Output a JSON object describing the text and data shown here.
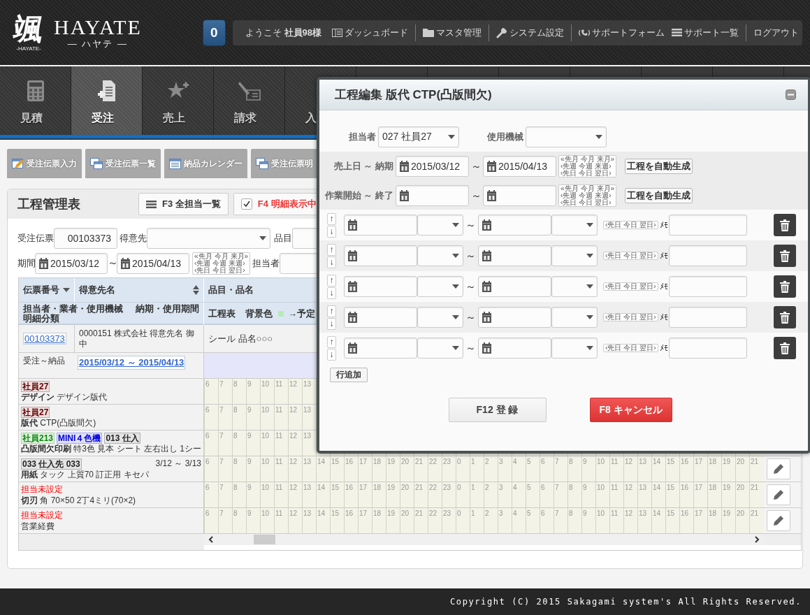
{
  "header": {
    "logo": {
      "mark": "颯",
      "tagline": "-HAYATE-",
      "name": "HAYATE",
      "reading": "— ハヤテ —"
    },
    "badge": "0",
    "greeting": "ようこそ **社員98様**",
    "links": [
      {
        "kind": "dashboard",
        "label": "ダッシュボード",
        "separated": false
      },
      {
        "kind": "folder",
        "label": "マスタ管理",
        "separated": true
      },
      {
        "kind": "settings",
        "label": "システム設定",
        "separated": true
      },
      {
        "kind": "phone",
        "label": "サポートフォーム",
        "separated": true
      },
      {
        "kind": "list",
        "label": "サポート一覧",
        "separated": false
      },
      {
        "kind": "logout",
        "label": "ログアウト",
        "separated": true
      }
    ]
  },
  "nav": {
    "tabs": [
      {
        "kind": "estimate",
        "label": "見積",
        "selected": false
      },
      {
        "kind": "order",
        "label": "受注",
        "selected": true
      },
      {
        "kind": "sales",
        "label": "売上",
        "selected": false
      },
      {
        "kind": "billing",
        "label": "請求",
        "selected": false
      },
      {
        "kind": "receipt",
        "label": "入",
        "selected": false
      }
    ]
  },
  "subnav": [
    {
      "kind": "edit",
      "label": "受注伝票入力"
    },
    {
      "kind": "windows",
      "label": "受注伝票一覧"
    },
    {
      "kind": "calendar",
      "label": "納品カレンダー"
    },
    {
      "kind": "windows",
      "label": "受注伝票明"
    }
  ],
  "panel": {
    "title": "工程管理表",
    "buttons": [
      {
        "kind": "list",
        "label": "F3 全担当一覧"
      },
      {
        "kind": "toggle",
        "label": "F4 明細表示中",
        "checked": true
      }
    ],
    "filters": {
      "order_no": {
        "label": "受注伝票",
        "value": "00103373"
      },
      "customer": {
        "label": "得意先"
      },
      "item": {
        "label": "品目"
      },
      "period": {
        "label": "期間",
        "from": "2015/03/12",
        "sep": "～",
        "to": "2015/04/13",
        "quick_pick": [
          [
            "«先月",
            "今月",
            "来月»"
          ],
          [
            "‹先週",
            "今週",
            "来週›"
          ],
          [
            "‹先日",
            "今日",
            "翌日›"
          ]
        ]
      },
      "staff": {
        "label": "担当者"
      }
    },
    "table": {
      "columns": [
        {
          "label": "伝票番号",
          "kind": "descending"
        },
        {
          "label": "得意先名",
          "kind": "sortable"
        },
        {
          "label": "品目・品名",
          "kind": "plain"
        }
      ],
      "subheader": {
        "assignee": "担当者・業者・使用機械",
        "due": "納期・使用期間",
        "category": "明細分類",
        "schedule": "工程表",
        "bg_label": "背景色",
        "legend": "→予定"
      },
      "order": {
        "number": "00103373",
        "customer": "0000151 株式会社 得意先名 御中",
        "item": "シール 品名○○○"
      },
      "span": {
        "label": "受注～納品",
        "dates": "2015/03/12 ～ 2015/04/13"
      },
      "rows": [
        {
          "tags": [
            {
              "kind": "tag",
              "text": "社員27",
              "color": "#660000"
            }
          ],
          "text": "**デザイン** デザイン版代",
          "hours": [
            "6",
            "7",
            "8",
            "9",
            "10",
            "11",
            "12",
            "13"
          ]
        },
        {
          "tags": [
            {
              "kind": "tag",
              "text": "社員27",
              "color": "#660000"
            }
          ],
          "text": "**版代** CTP(凸版間欠)",
          "hours": [
            "6",
            "7",
            "8",
            "9",
            "10",
            "11",
            "12",
            "13"
          ]
        },
        {
          "tags": [
            {
              "kind": "tag",
              "text": "社員213",
              "color": "#0a8a0a"
            },
            {
              "kind": "tag",
              "text": "MINI４色機",
              "color": "#0000dd"
            },
            {
              "kind": "tag",
              "text": "013 仕入",
              "color": "#222222"
            }
          ],
          "text": "**凸版間欠印刷** 特3色 見本 シート 左右出し 1シー",
          "hours": [
            "6",
            "7",
            "8",
            "9",
            "10",
            "11",
            "12",
            "13"
          ]
        },
        {
          "tags": [
            {
              "kind": "tag",
              "text": "033 仕入先 033",
              "color": "#222222"
            }
          ],
          "period": "3/12 ～ 3/13",
          "text": "**用紙** タック 上質70 訂正用 キセパ",
          "editable": true,
          "hours": [
            "6",
            "7",
            "8",
            "9",
            "10",
            "11",
            "12",
            "13",
            "14",
            "15",
            "16",
            "17",
            "18",
            "19",
            "20",
            "21",
            "22",
            "23",
            "0",
            "1",
            "2",
            "3",
            "4",
            "5",
            "6",
            "7",
            "8",
            "9",
            "10",
            "11",
            "12",
            "13",
            "14",
            "15",
            "16",
            "17",
            "18",
            "19",
            "20",
            "21"
          ]
        },
        {
          "tags": [
            {
              "kind": "plain",
              "text": "担当未設定"
            }
          ],
          "text": "**切刃** 角 70×50 2丁4ミリ(70×2)",
          "editable": true,
          "hours": [
            "6",
            "7",
            "8",
            "9",
            "10",
            "11",
            "12",
            "13",
            "14",
            "15",
            "16",
            "17",
            "18",
            "19",
            "20",
            "21",
            "22",
            "23",
            "0",
            "1",
            "2",
            "3",
            "4",
            "5",
            "6",
            "7",
            "8",
            "9",
            "10",
            "11",
            "12",
            "13",
            "14",
            "15",
            "16",
            "17",
            "18",
            "19",
            "20",
            "21"
          ]
        },
        {
          "tags": [
            {
              "kind": "plain",
              "text": "担当未設定"
            }
          ],
          "text": "営業経費",
          "editable": true,
          "hours": [
            "6",
            "7",
            "8",
            "9",
            "10",
            "11",
            "12",
            "13",
            "14",
            "15",
            "16",
            "17",
            "18",
            "19",
            "20",
            "21",
            "22",
            "23",
            "0",
            "1",
            "2",
            "3",
            "4",
            "5",
            "6",
            "7",
            "8",
            "9",
            "10",
            "11",
            "12",
            "13",
            "14",
            "15",
            "16",
            "17",
            "18",
            "19",
            "20",
            "21"
          ]
        }
      ]
    }
  },
  "modal": {
    "title": "工程編集 版代 CTP(凸版間欠)",
    "staff": {
      "label": "担当者",
      "value": "027 社員27"
    },
    "machine": {
      "label": "使用機械"
    },
    "ranges": [
      {
        "label": "売上日 ～ 納期",
        "from": "2015/03/12",
        "sep": "～",
        "to": "2015/04/13",
        "quick_pick": [
          [
            "«先月",
            "今月",
            "来月»"
          ],
          [
            "‹先週",
            "今週",
            "来週›"
          ],
          [
            "‹先日",
            "今日",
            "翌日›"
          ]
        ],
        "button": "工程を自動生成"
      },
      {
        "label": "作業開始 ～ 終了",
        "sep": "～",
        "quick_pick": [
          [
            "«先月",
            "今月",
            "来月»"
          ],
          [
            "‹先週",
            "今週",
            "来週›"
          ],
          [
            "‹先日",
            "今日",
            "翌日›"
          ]
        ],
        "button": "工程を自動生成"
      }
    ],
    "steps": [
      {
        "up": "↑",
        "down": "↓",
        "sep": "～",
        "quick_pick": [
          "‹先日",
          "今日",
          "翌日›"
        ],
        "memo_label": "ﾒﾓ"
      },
      {
        "up": "↑",
        "down": "↓",
        "sep": "～",
        "quick_pick": [
          "‹先日",
          "今日",
          "翌日›"
        ],
        "memo_label": "ﾒﾓ"
      },
      {
        "up": "↑",
        "down": "↓",
        "sep": "～",
        "quick_pick": [
          "‹先日",
          "今日",
          "翌日›"
        ],
        "memo_label": "ﾒﾓ"
      },
      {
        "up": "↑",
        "down": "↓",
        "sep": "～",
        "quick_pick": [
          "‹先日",
          "今日",
          "翌日›"
        ],
        "memo_label": "ﾒﾓ"
      },
      {
        "up": "↑",
        "down": "↓",
        "sep": "～",
        "quick_pick": [
          "‹先日",
          "今日",
          "翌日›"
        ],
        "memo_label": "ﾒﾓ"
      }
    ],
    "add_row": "行追加",
    "submit": "F12 登 録",
    "cancel": "F8 キャンセル"
  },
  "footer": "Copyright (C) 2015 Sakagami system's All Rights Reserved."
}
